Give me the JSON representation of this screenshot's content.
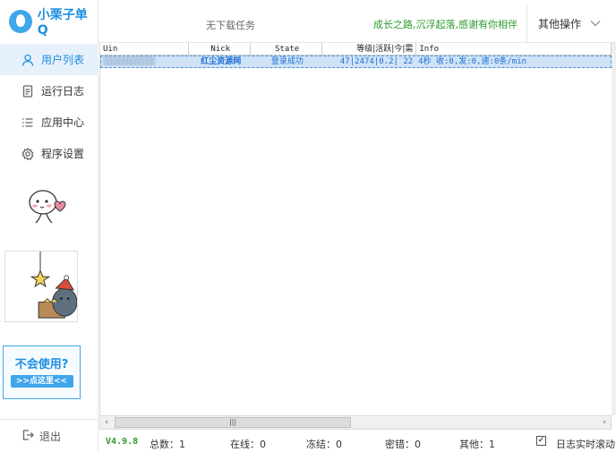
{
  "app": {
    "title": "小栗子单Q"
  },
  "sidebar": {
    "items": [
      {
        "label": "用户列表",
        "icon": "user-icon",
        "active": true
      },
      {
        "label": "运行日志",
        "icon": "document-icon",
        "active": false
      },
      {
        "label": "应用中心",
        "icon": "list-icon",
        "active": false
      },
      {
        "label": "程序设置",
        "icon": "gear-icon",
        "active": false
      }
    ],
    "help": {
      "title": "不会使用?",
      "button": ">>点这里<<"
    },
    "logout": "退出"
  },
  "header": {
    "task": "无下载任务",
    "slogan": "成长之路,沉浮起落,感谢有你相伴",
    "more_ops": "其他操作"
  },
  "table": {
    "columns": [
      "Uin",
      "Nick",
      "State",
      "等级|活跃|今|需",
      "Info"
    ],
    "rows": [
      {
        "uin": "",
        "nick": "红尘资源网",
        "state": "登录成功",
        "level": "47|2474|0.2| 22",
        "info": "4秒 收:0,发:0,速:0条/min"
      }
    ]
  },
  "statusbar": {
    "version": "V4.9.8",
    "total": "总数：1",
    "online": "在线：0",
    "frozen": "冻结：0",
    "password_error": "密错：0",
    "other": "其他：1",
    "log_realtime": "日志实时滚动",
    "log_realtime_checked": true
  },
  "colors": {
    "accent": "#1e8fe1",
    "slogan": "#2e9a2e",
    "row_highlight": "#cfe3f7"
  }
}
